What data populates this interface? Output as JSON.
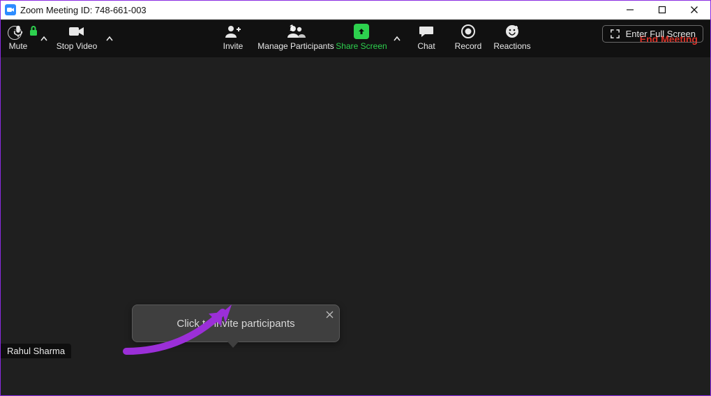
{
  "title": "Zoom Meeting ID: 748-661-003",
  "full_screen_label": "Enter Full Screen",
  "participant_name": "Rahul Sharma",
  "tooltip_text": "Click to invite participants",
  "participant_count": "1",
  "toolbar": {
    "mute": "Mute",
    "stop_video": "Stop Video",
    "invite": "Invite",
    "manage": "Manage Participants",
    "share": "Share Screen",
    "chat": "Chat",
    "record": "Record",
    "reactions": "Reactions",
    "end": "End Meeting"
  }
}
